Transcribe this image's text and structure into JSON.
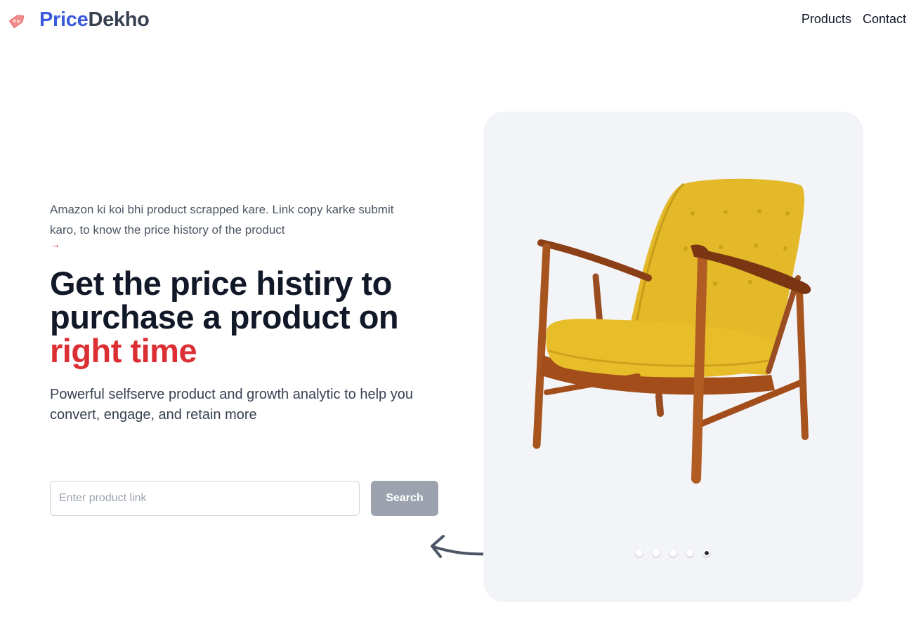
{
  "header": {
    "logo_part1": "Price",
    "logo_part2": "Dekho",
    "logo_icon": "price-tag-icon",
    "nav": [
      {
        "label": "Products"
      },
      {
        "label": "Contact"
      }
    ]
  },
  "hero": {
    "tagline": "Amazon ki koi bhi product scrapped kare. Link copy karke submit karo, to know the price history of the product",
    "tagline_arrow": "→",
    "headline_line": "Get the price histiry to purchase a product on",
    "headline_accent": "right time",
    "subtitle": "Powerful selfserve product and growth analytic to help you convert, engage, and retain more",
    "search": {
      "placeholder": "Enter product link",
      "value": "",
      "button_label": "Search"
    }
  },
  "carousel": {
    "image": "yellow-armchair",
    "slide_count": 5,
    "active_slide": 5
  },
  "colors": {
    "brand_blue": "#3b5bdb",
    "accent_red": "#dc2f34",
    "button_gray": "#9ca3af",
    "carousel_bg": "#f3f4f7"
  }
}
